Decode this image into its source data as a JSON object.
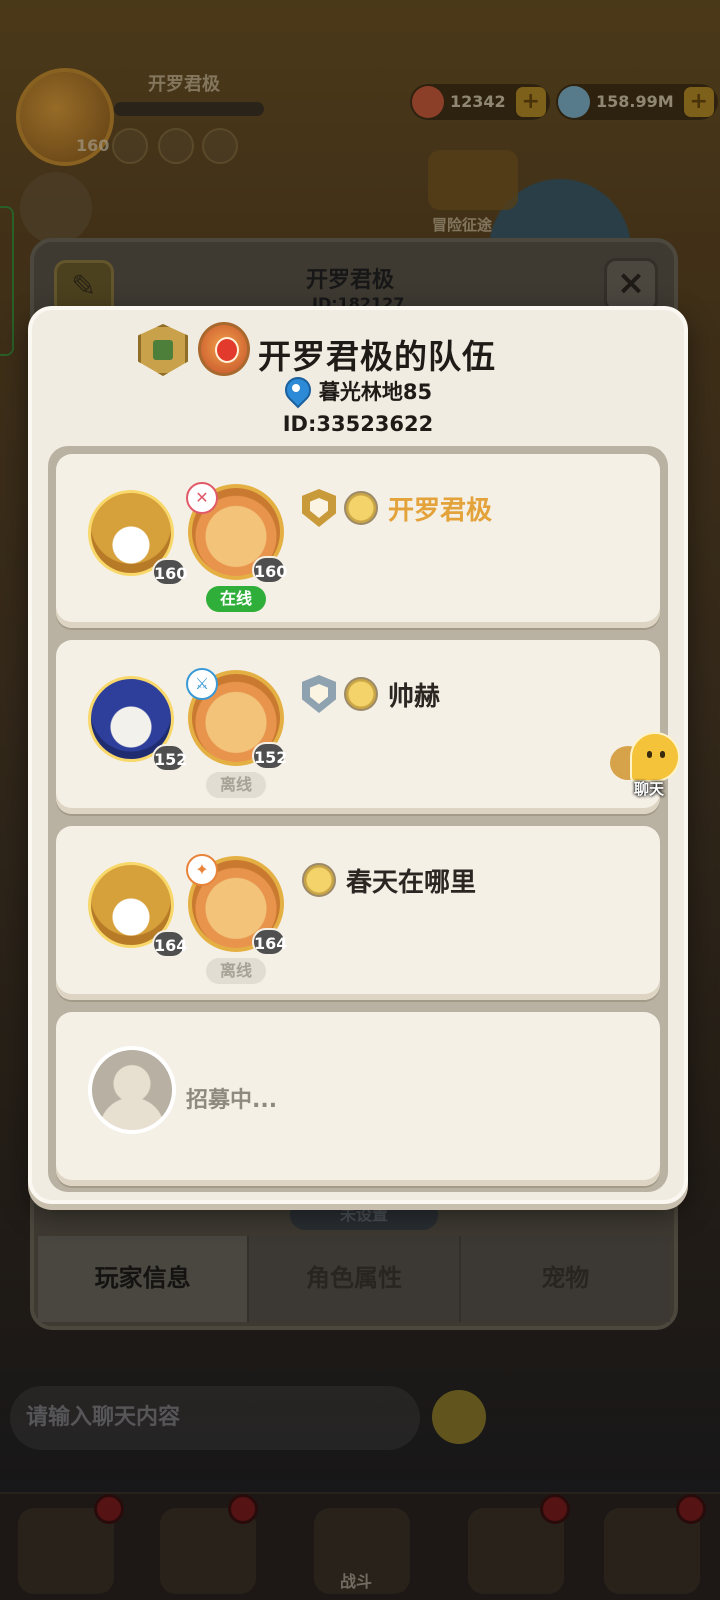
{
  "background": {
    "player_name": "开罗君极",
    "player_level": "160",
    "currency_1": "12342",
    "currency_2": "158.99M",
    "adventure_label": "冒险征途",
    "profile_title": "开罗君极",
    "profile_id": "ID:182127",
    "unset_label": "未设置",
    "tabs": [
      {
        "label": "玩家信息",
        "active": true
      },
      {
        "label": "角色属性",
        "active": false
      },
      {
        "label": "宠物",
        "active": false
      }
    ],
    "chat_placeholder": "请输入聊天内容",
    "battle_label": "战斗"
  },
  "team": {
    "title": "开罗君极的队伍",
    "location": "暮光林地85",
    "id": "ID:33523622",
    "members": [
      {
        "name": "开罗君极",
        "hero_level": "160",
        "pet_level": "160",
        "status": "在线",
        "online": true,
        "shield": "gold-shield-icon",
        "is_self": true
      },
      {
        "name": "帅赫",
        "hero_level": "152",
        "pet_level": "152",
        "status": "离线",
        "online": false,
        "shield": "silver-shield-icon",
        "is_self": false
      },
      {
        "name": "春天在哪里",
        "hero_level": "164",
        "pet_level": "164",
        "status": "离线",
        "online": false,
        "shield": null,
        "is_self": false
      }
    ],
    "recruiting_label": "招募中..."
  },
  "chat_button": {
    "label": "聊天"
  },
  "colors": {
    "self_name": "#e3a23a",
    "online": "#2fae3a",
    "offline_bg": "#e2ddd3",
    "modal_bg": "#f1ece2"
  }
}
